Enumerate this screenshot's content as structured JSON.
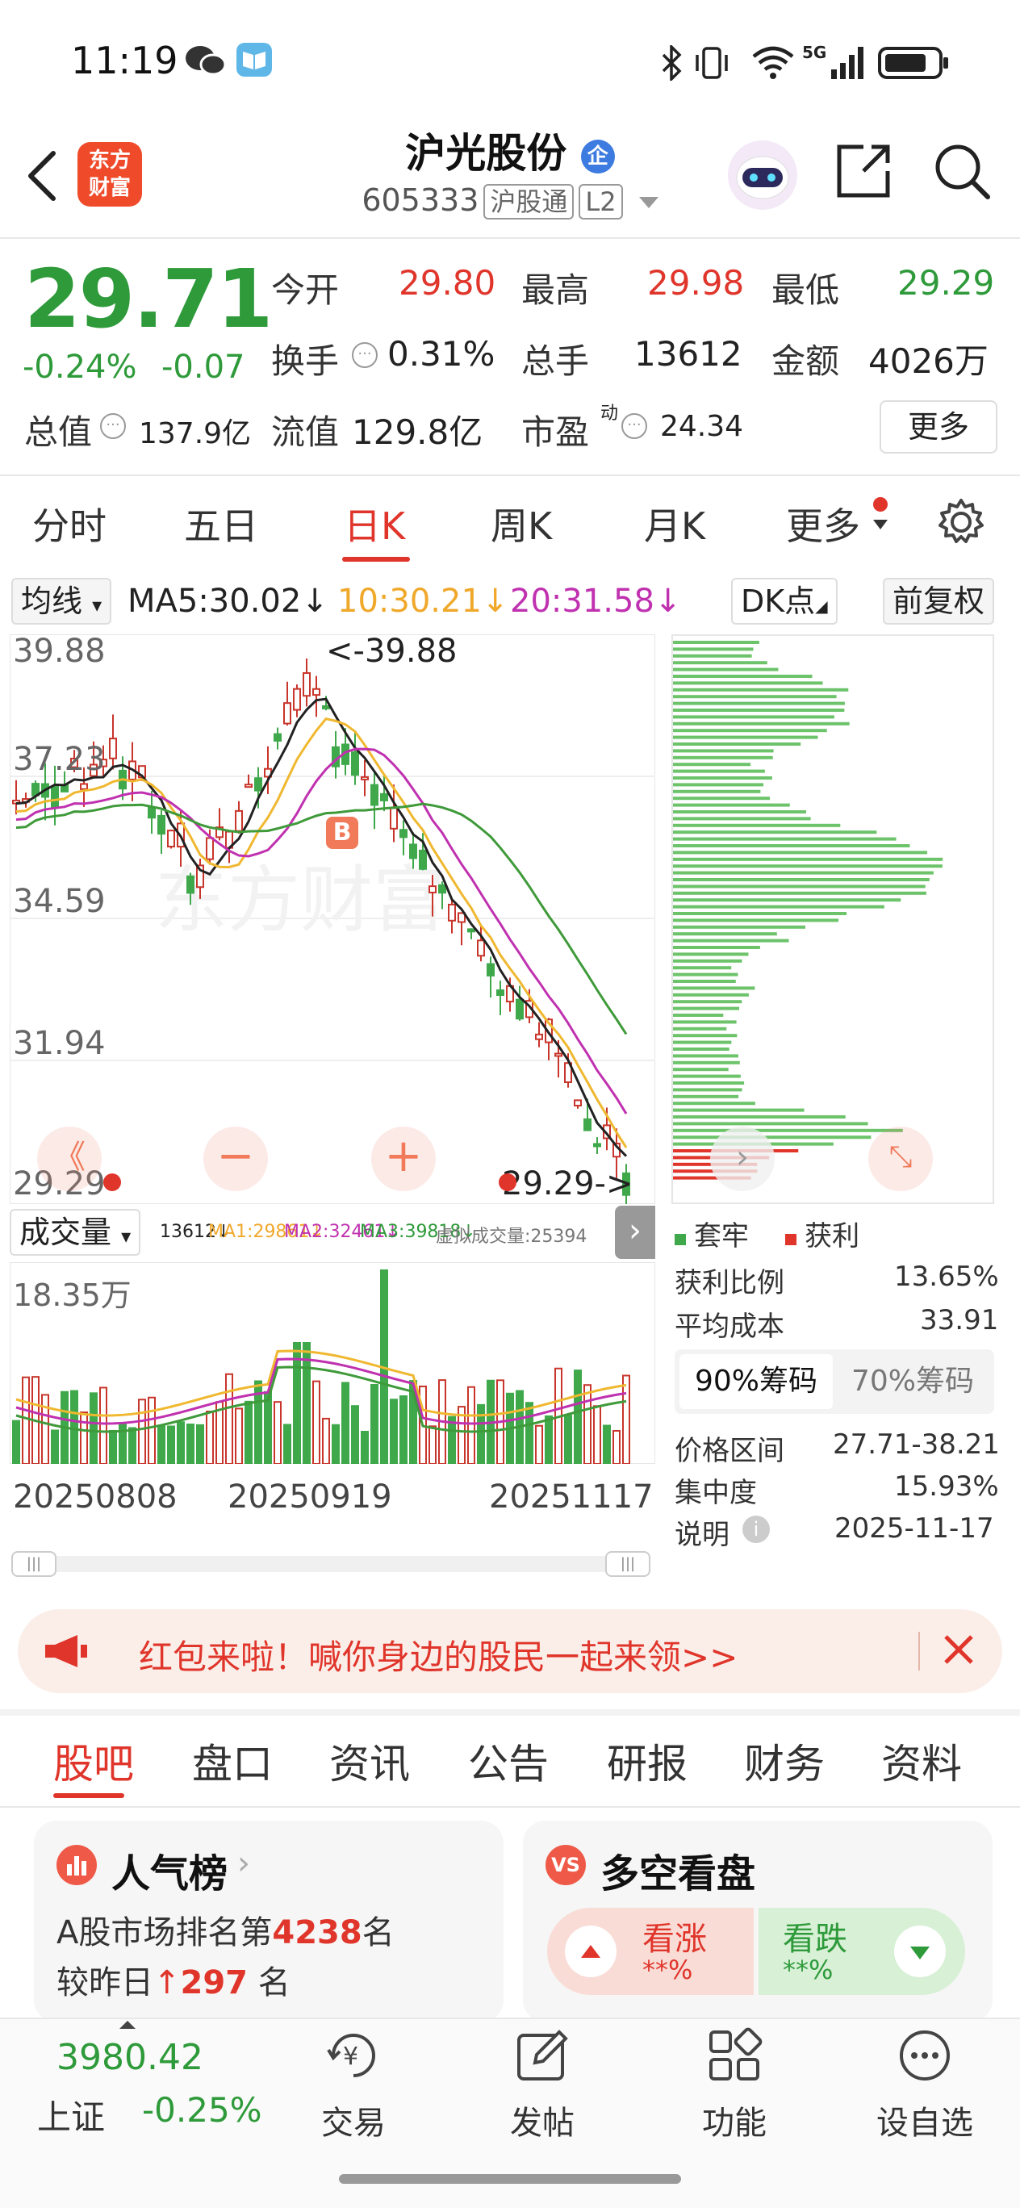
{
  "status": {
    "time": "11:19"
  },
  "header": {
    "name": "沪光股份",
    "code": "605333",
    "tag1": "沪股通",
    "tag2": "L2",
    "logo_text": "东方财富"
  },
  "quote": {
    "price": "29.71",
    "pct": "-0.24%",
    "change": "-0.07",
    "open_label": "今开",
    "open": "29.80",
    "high_label": "最高",
    "high": "29.98",
    "low_label": "最低",
    "low": "29.29",
    "turnover_label": "换手",
    "turnover": "0.31%",
    "volume_label": "总手",
    "volume": "13612",
    "amount_label": "金额",
    "amount": "4026万",
    "mcap_label": "总值",
    "mcap": "137.9亿",
    "float_label": "流值",
    "float": "129.8亿",
    "pe_label": "市盈",
    "pe_sup": "动",
    "pe": "24.34",
    "more": "更多"
  },
  "tabs": [
    "分时",
    "五日",
    "日K",
    "周K",
    "月K",
    "更多"
  ],
  "chart": {
    "ma_label": "均线",
    "ma5": "MA5:30.02↓",
    "ma10": "10:30.21↓",
    "ma20": "20:31.58↓",
    "dk": "DK点",
    "fq": "前复权",
    "ymax": "39.88",
    "y2": "37.23",
    "y3": "34.59",
    "y4": "31.94",
    "ymin": "29.29",
    "high_note": "<-39.88",
    "low_note": "29.29->",
    "b_marker": "B",
    "vol_label": "成交量",
    "vol_info": [
      "13612↓",
      "MA1:29861↓",
      "MA2:32461↓",
      "MA3:39818↓",
      "虚拟成交量:25394"
    ],
    "vol_max": "18.35万",
    "dates": [
      "20250808",
      "20250919",
      "20251117"
    ]
  },
  "chips": {
    "legend_trap": "套牢",
    "legend_profit": "获利",
    "profit_ratio_label": "获利比例",
    "profit_ratio": "13.65%",
    "avg_cost_label": "平均成本",
    "avg_cost": "33.91",
    "tab90": "90%筹码",
    "tab70": "70%筹码",
    "range_label": "价格区间",
    "range": "27.71-38.21",
    "conc_label": "集中度",
    "conc": "15.93%",
    "note_label": "说明",
    "note_date": "2025-11-17"
  },
  "banner": {
    "text": "红包来啦！喊你身边的股民一起来领>>"
  },
  "bottom_tabs": [
    "股吧",
    "盘口",
    "资讯",
    "公告",
    "研报",
    "财务",
    "资料"
  ],
  "cards": {
    "pop_title": "人气榜",
    "pop_line1a": "A股市场排名第",
    "pop_rank": "4238",
    "pop_line1b": "名",
    "pop_line2a": "较昨日",
    "pop_delta": "297",
    "pop_line2b": "名",
    "vs_title": "多空看盘",
    "up_label": "看涨",
    "up_val": "**%",
    "down_label": "看跌",
    "down_val": "**%"
  },
  "nav": {
    "index_value": "3980.42",
    "index_name": "上证",
    "index_pct": "-0.25%",
    "items": [
      "交易",
      "发帖",
      "功能",
      "设自选"
    ]
  }
}
